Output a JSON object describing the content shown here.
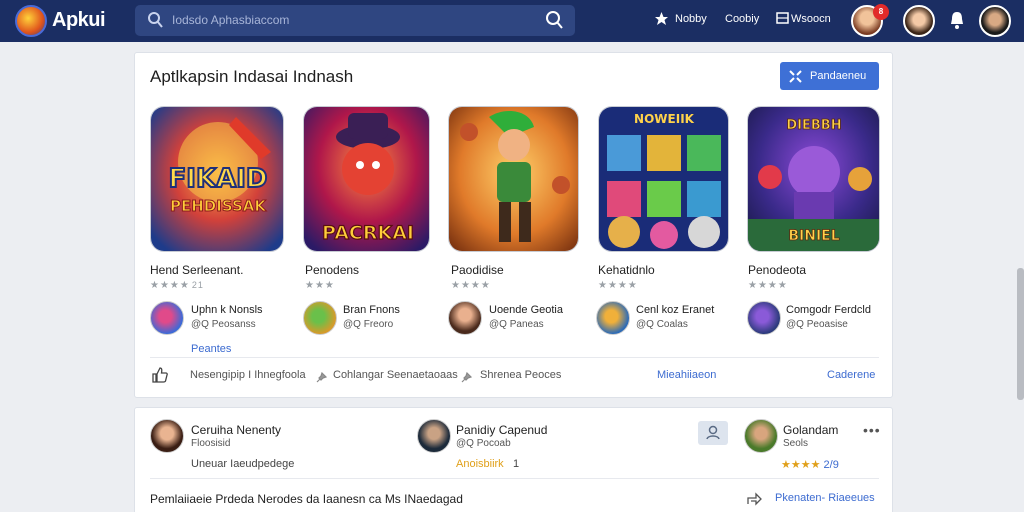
{
  "topbar": {
    "brand": "Apkui",
    "search_placeholder": "Iodsdo Aphasbiaccom",
    "nav": [
      "Nobby",
      "Coobiy",
      "Wsoocn"
    ],
    "notification_count": "8"
  },
  "section": {
    "title": "Aptlkapsin Indasai Indnash",
    "header_button": "Pandaeneu",
    "apps": [
      {
        "name": "Hend Serleenant.",
        "rating_count": "21",
        "tile_text": [
          "FIKAID",
          "PEHDISSAK"
        ],
        "dev_name": "Uphn k Nonsls",
        "dev_handle": "@Q Peosanss"
      },
      {
        "name": "Penodens",
        "rating_count": "",
        "tile_text": [
          "PACRKAI"
        ],
        "dev_name": "Bran Fnons",
        "dev_handle": "@Q Freoro"
      },
      {
        "name": "Paodidise",
        "rating_count": "",
        "tile_text": [],
        "dev_name": "Uoende Geotia",
        "dev_handle": "@Q Paneas"
      },
      {
        "name": "Kehatidnlo",
        "rating_count": "",
        "tile_text": [
          "NOWEIIK"
        ],
        "dev_name": "Cenl koz Eranet",
        "dev_handle": "@Q Coalas"
      },
      {
        "name": "Penodeota",
        "rating_count": "",
        "tile_text": [
          "DIEBBH",
          "BINIEL"
        ],
        "dev_name": "Comgodr Ferdcld",
        "dev_handle": "@Q Peoasise"
      }
    ],
    "first_dev_link": "Peantes",
    "footer_items": [
      "Nesengipip I Ihnegfoola",
      "Cohlangar Seenaetaoaas",
      "Shrenea Peoces"
    ],
    "footer_link_1": "Mieahiiaeon",
    "footer_link_2": "Caderene"
  },
  "feed": {
    "users": [
      {
        "name": "Ceruiha Nenenty",
        "sub": "Floosisid",
        "row": "Uneuar Iaeudpedege"
      },
      {
        "name": "Panidiy Capenud",
        "sub": "@Q Pocoab",
        "row": "Anoisbiirk",
        "row_count": "1"
      },
      {
        "name": "Golandam",
        "sub": "Seols",
        "rating": "2/9"
      }
    ],
    "post_text": "Pemlaiiaeie Prdeda Nerodes da Iaanesn ca Ms INaedagad",
    "share_link": "Pkenaten- Riaeeues"
  }
}
